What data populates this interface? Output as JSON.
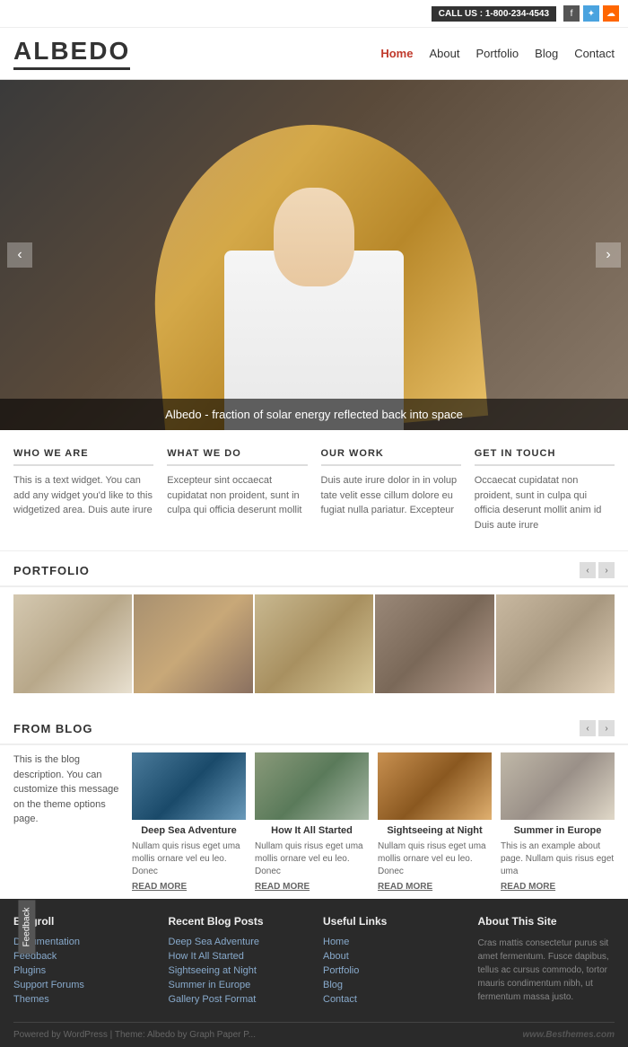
{
  "topbar": {
    "call_us": "CALL US : 1-800-234-4543",
    "social": [
      {
        "name": "facebook",
        "icon": "f"
      },
      {
        "name": "twitter",
        "icon": "t"
      },
      {
        "name": "rss",
        "icon": "⊕"
      }
    ]
  },
  "header": {
    "logo": "ALBEDO",
    "nav": [
      {
        "label": "Home",
        "active": true
      },
      {
        "label": "About",
        "active": false
      },
      {
        "label": "Portfolio",
        "active": false
      },
      {
        "label": "Blog",
        "active": false
      },
      {
        "label": "Contact",
        "active": false
      }
    ]
  },
  "hero": {
    "caption": "Albedo - fraction of solar energy reflected back into space",
    "arrow_left": "‹",
    "arrow_right": "›"
  },
  "info": [
    {
      "title": "WHO WE ARE",
      "text": "This is a text widget. You can add any widget you'd like to this widgetized area. Duis aute irure"
    },
    {
      "title": "WHAT WE DO",
      "text": "Excepteur sint occaecat cupidatat non proident, sunt in culpa qui officia deserunt mollit"
    },
    {
      "title": "OUR WORK",
      "text": "Duis aute irure dolor in in volup tate velit esse cillum dolore eu fugiat nulla pariatur. Excepteur"
    },
    {
      "title": "GET IN TOUCH",
      "text": "Occaecat cupidatat non proident, sunt in culpa qui officia deserunt mollit anim id Duis aute irure"
    }
  ],
  "portfolio": {
    "title": "PORTFOLIO",
    "nav_left": "‹",
    "nav_right": "›",
    "items": [
      {
        "bg_class": "pt1"
      },
      {
        "bg_class": "pt2"
      },
      {
        "bg_class": "pt3"
      },
      {
        "bg_class": "pt4"
      },
      {
        "bg_class": "pt5"
      }
    ]
  },
  "blog": {
    "title": "FROM BLOG",
    "nav_left": "‹",
    "nav_right": "›",
    "description": "This is the blog description. You can customize this message on the theme options page.",
    "posts": [
      {
        "title": "Deep Sea Adventure",
        "text": "Nullam quis risus eget uma mollis ornare vel eu leo. Donec",
        "read_more": "READ MORE",
        "bg_class": "bt1"
      },
      {
        "title": "How It All Started",
        "text": "Nullam quis risus eget uma mollis ornare vel eu leo. Donec",
        "read_more": "READ MORE",
        "bg_class": "bt2"
      },
      {
        "title": "Sightseeing at Night",
        "text": "Nullam quis risus eget uma mollis ornare vel eu leo. Donec",
        "read_more": "READ MORE",
        "bg_class": "bt3"
      },
      {
        "title": "Summer in Europe",
        "text": "This is an example about page. Nullam quis risus eget uma",
        "read_more": "READ MORE",
        "bg_class": "bt4"
      }
    ]
  },
  "footer": {
    "cols": [
      {
        "title": "Blogroll",
        "links": [
          "Documentation",
          "Feedback",
          "Plugins",
          "Support Forums",
          "Themes"
        ]
      },
      {
        "title": "Recent Blog Posts",
        "links": [
          "Deep Sea Adventure",
          "How It All Started",
          "Sightseeing at Night",
          "Summer in Europe",
          "Gallery Post Format"
        ]
      },
      {
        "title": "Useful Links",
        "links": [
          "Home",
          "About",
          "Portfolio",
          "Blog",
          "Contact"
        ]
      },
      {
        "title": "About This Site",
        "text": "Cras mattis consectetur purus sit amet fermentum. Fusce dapibus, tellus ac cursus commodo, tortor mauris condimentum nibh, ut fermentum massa justo."
      }
    ],
    "bottom_left": "Powered by WordPress  |  Theme: Albedo by Graph Paper P...",
    "bottom_right": "www.Besthemes.com"
  },
  "feedback": {
    "label": "Feedback"
  }
}
